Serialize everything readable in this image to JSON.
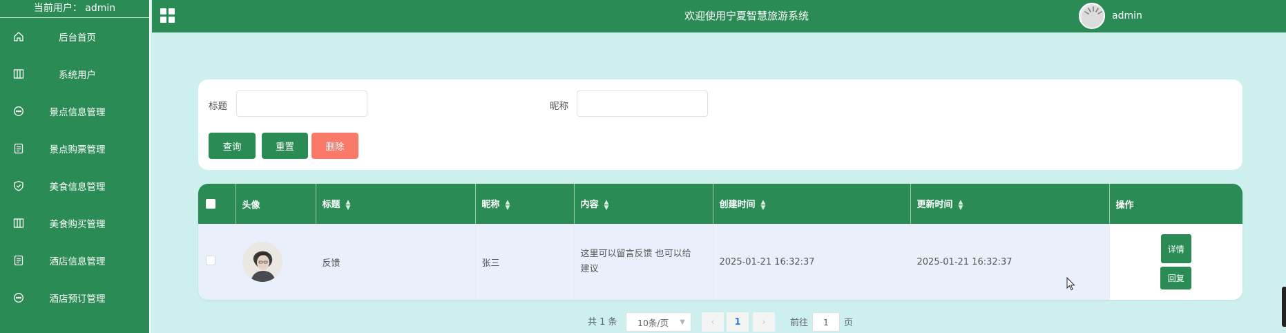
{
  "app": {
    "title": "欢迎使用宁夏智慧旅游系统",
    "brand_color": "#2a8b55",
    "danger_color": "#fa7a6a",
    "page_background": "#cdf0ef"
  },
  "sidebar": {
    "current_user": "当前用户： admin",
    "items": [
      {
        "label": "后台首页",
        "icon": "home-icon"
      },
      {
        "label": "系统用户",
        "icon": "columns-icon"
      },
      {
        "label": "景点信息管理",
        "icon": "chat-icon"
      },
      {
        "label": "景点购票管理",
        "icon": "document-icon"
      },
      {
        "label": "美食信息管理",
        "icon": "shield-icon"
      },
      {
        "label": "美食购买管理",
        "icon": "columns-icon"
      },
      {
        "label": "酒店信息管理",
        "icon": "document-icon"
      },
      {
        "label": "酒店预订管理",
        "icon": "chat-icon"
      }
    ]
  },
  "header": {
    "menu_icon": "grid-icon",
    "user_name": "admin"
  },
  "search": {
    "title_label": "标题",
    "title_value": "",
    "nickname_label": "昵称",
    "nickname_value": "",
    "query_button": "查询",
    "reset_button": "重置",
    "delete_button": "删除"
  },
  "table": {
    "columns": [
      "头像",
      "标题",
      "昵称",
      "内容",
      "创建时间",
      "更新时间",
      "操作"
    ],
    "rows": [
      {
        "title": "反馈",
        "nickname": "张三",
        "content": "这里可以留言反馈 也可以给建议",
        "created": "2025-01-21 16:32:37",
        "updated": "2025-01-21 16:32:37",
        "detail_button": "详情",
        "reply_button": "回复"
      }
    ]
  },
  "pagination": {
    "total": "共 1 条",
    "page_size": "10条/页",
    "current_page": "1",
    "goto_label": "前往",
    "goto_value": "1",
    "page_unit": "页"
  }
}
